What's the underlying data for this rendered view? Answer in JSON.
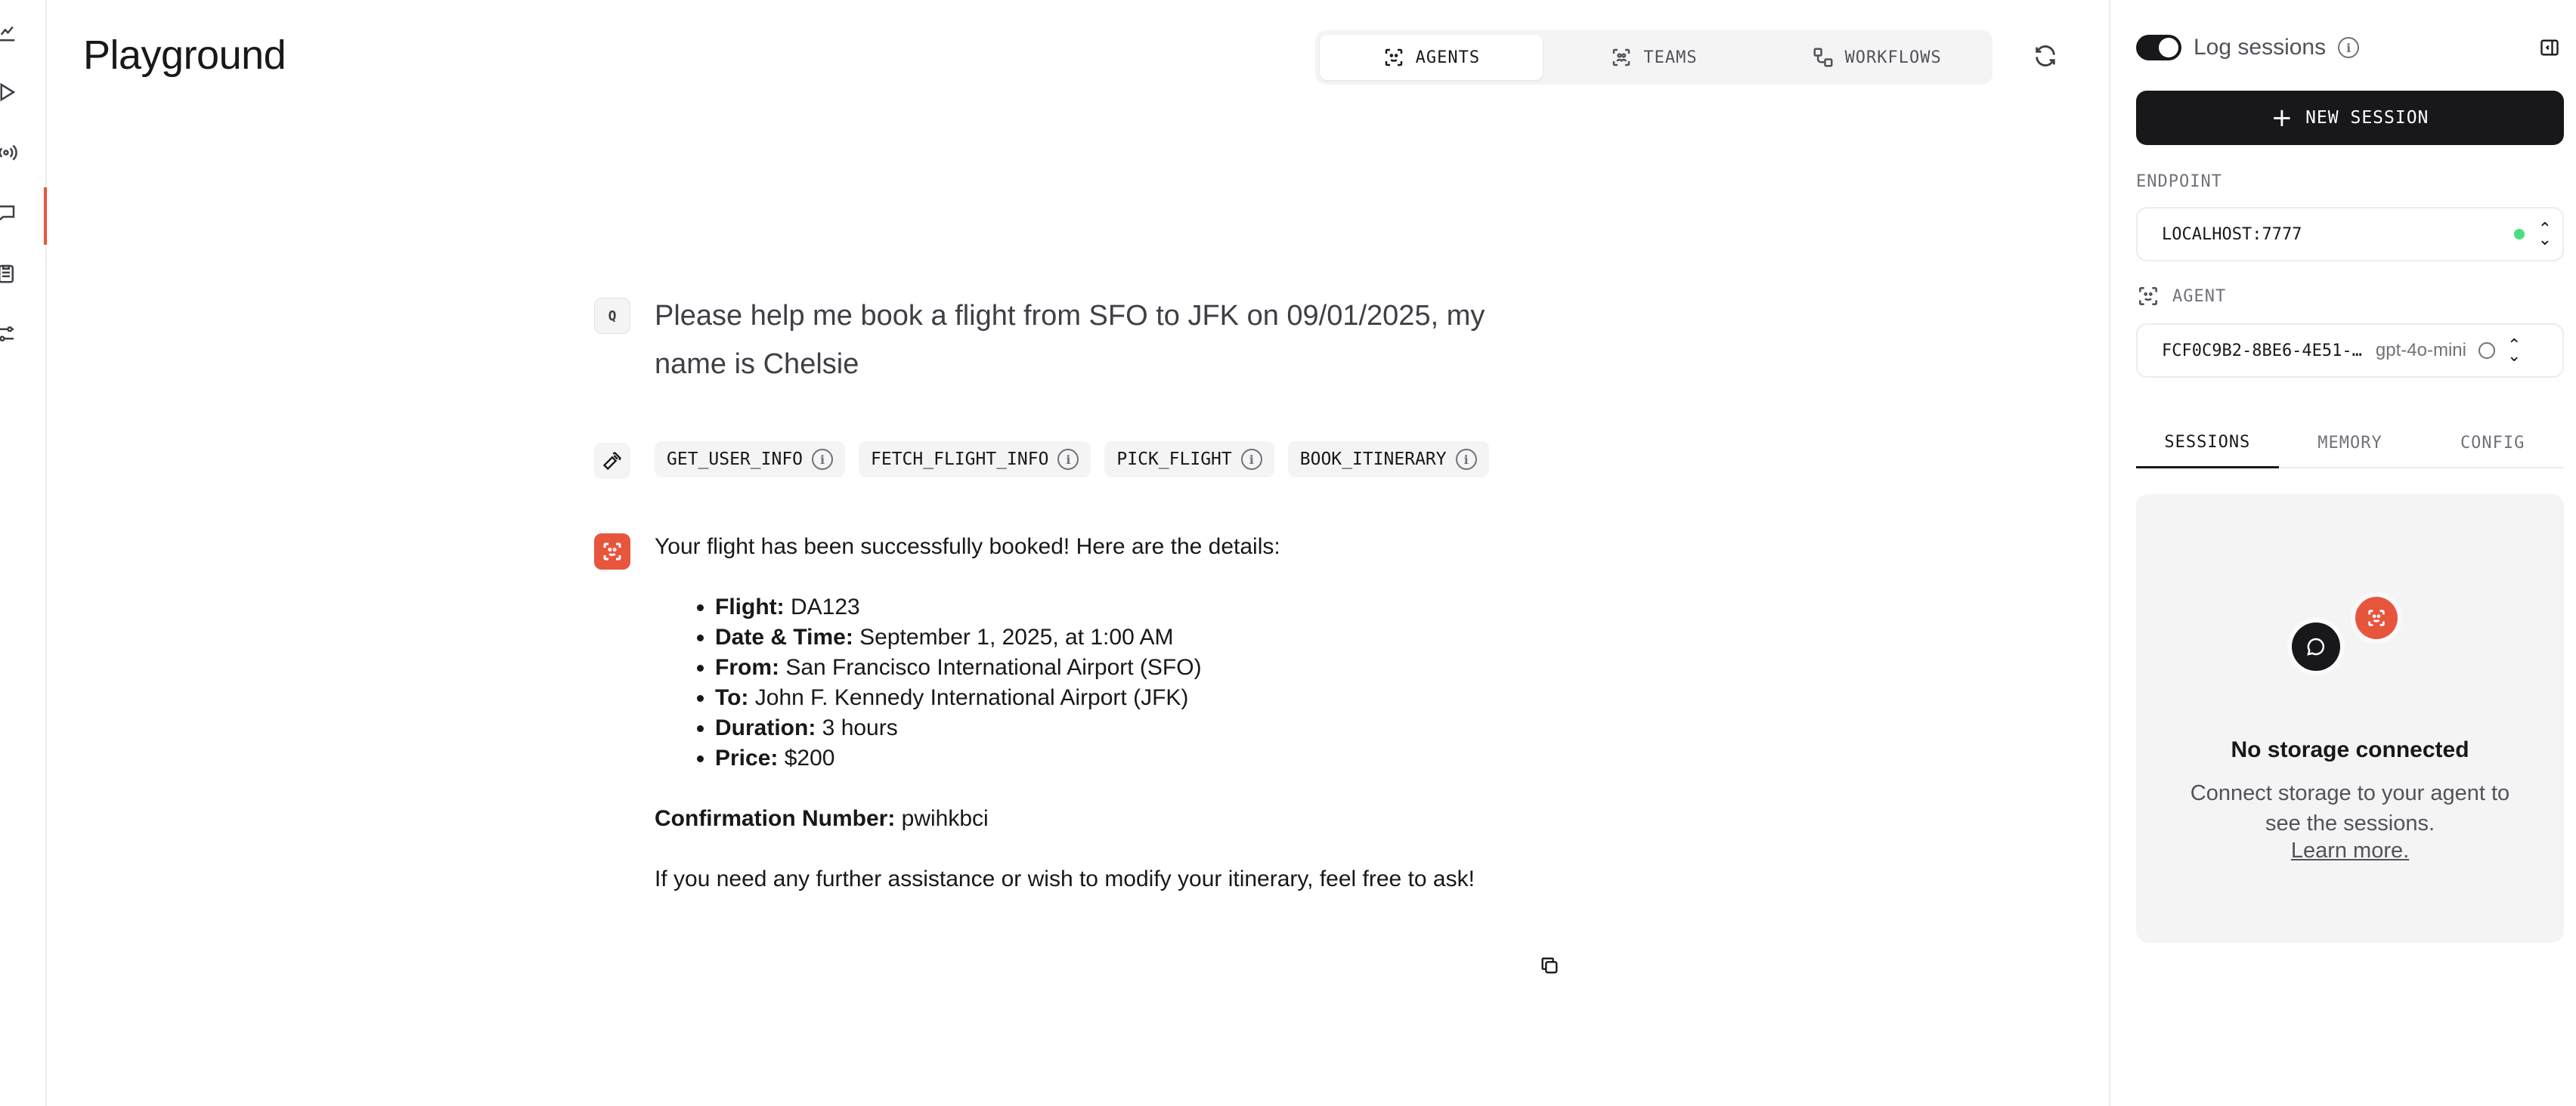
{
  "header": {
    "title": "Playground",
    "tabs": [
      {
        "label": "AGENTS",
        "icon": "agent-icon",
        "active": true
      },
      {
        "label": "TEAMS",
        "icon": "teams-icon",
        "active": false
      },
      {
        "label": "WORKFLOWS",
        "icon": "workflow-icon",
        "active": false
      }
    ]
  },
  "rail": {
    "items": [
      "chart-icon",
      "play-icon",
      "broadcast-icon",
      "chat-icon",
      "clipboard-icon",
      "sliders-icon"
    ],
    "active": "chat-icon"
  },
  "chat": {
    "user_badge": "Q",
    "user_message": "Please help me book a flight from SFO to JFK on 09/01/2025, my name is Chelsie",
    "tools": [
      "GET_USER_INFO",
      "FETCH_FLIGHT_INFO",
      "PICK_FLIGHT",
      "BOOK_ITINERARY"
    ],
    "response": {
      "intro": "Your flight has been successfully booked! Here are the details:",
      "details": [
        {
          "label": "Flight:",
          "value": "DA123"
        },
        {
          "label": "Date & Time:",
          "value": "September 1, 2025, at 1:00 AM"
        },
        {
          "label": "From:",
          "value": "San Francisco International Airport (SFO)"
        },
        {
          "label": "To:",
          "value": "John F. Kennedy International Airport (JFK)"
        },
        {
          "label": "Duration:",
          "value": "3 hours"
        },
        {
          "label": "Price:",
          "value": "$200"
        }
      ],
      "confirmation_label": "Confirmation Number:",
      "confirmation_value": "pwihkbci",
      "closing": "If you need any further assistance or wish to modify your itinerary, feel free to ask!"
    }
  },
  "sidebar": {
    "log_sessions_label": "Log sessions",
    "new_session_label": "NEW SESSION",
    "endpoint_label": "ENDPOINT",
    "endpoint_value": "LOCALHOST:7777",
    "agent_label": "AGENT",
    "agent_value": "FCF0C9B2-8BE6-4E51-…",
    "agent_model": "gpt-4o-mini",
    "tabs": [
      {
        "label": "SESSIONS",
        "active": true
      },
      {
        "label": "MEMORY",
        "active": false
      },
      {
        "label": "CONFIG",
        "active": false
      }
    ],
    "empty_title": "No storage connected",
    "empty_desc": "Connect storage to your agent to see the sessions.",
    "learn_more": "Learn more."
  },
  "colors": {
    "accent": "#e8553d",
    "status_ok": "#4ade80",
    "primary": "#18181b"
  }
}
